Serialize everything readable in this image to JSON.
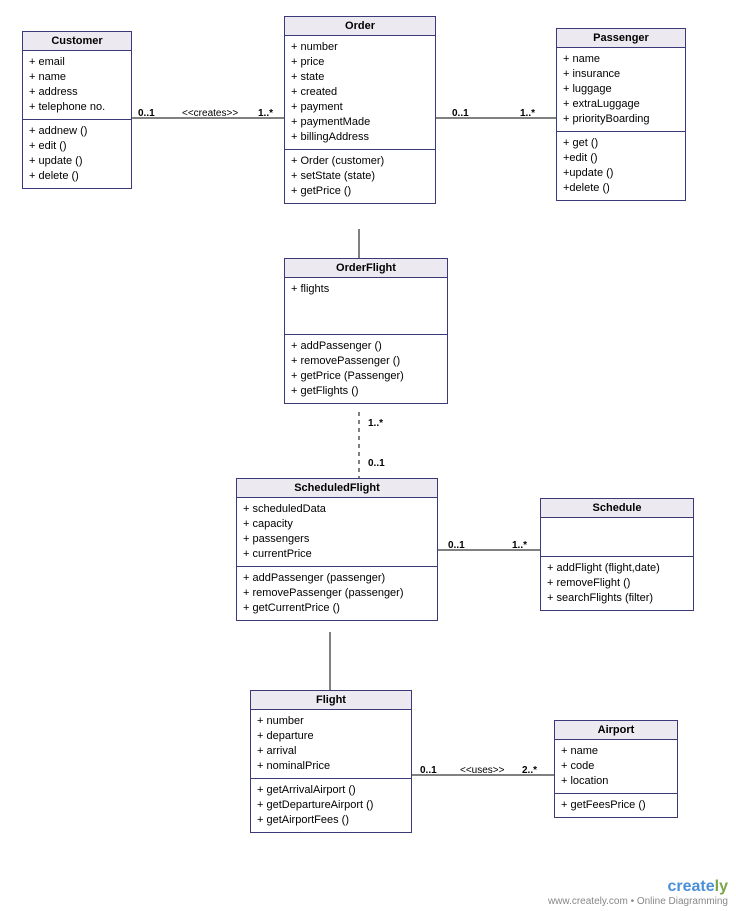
{
  "classes": {
    "customer": {
      "name": "Customer",
      "attrs": [
        "+ email",
        "+ name",
        "+ address",
        "+ telephone no."
      ],
      "ops": [
        "+ addnew ()",
        "+ edit ()",
        "+ update ()",
        "+ delete ()"
      ]
    },
    "order": {
      "name": "Order",
      "attrs": [
        "+ number",
        "+ price",
        "+ state",
        "+ created",
        "+ payment",
        "+ paymentMade",
        "+ billingAddress"
      ],
      "ops": [
        "+ Order (customer)",
        "+ setState (state)",
        "+ getPrice ()"
      ]
    },
    "passenger": {
      "name": "Passenger",
      "attrs": [
        "+ name",
        "+ insurance",
        "+ luggage",
        "+ extraLuggage",
        "+ priorityBoarding"
      ],
      "ops": [
        "+ get ()",
        "+edit ()",
        "+update ()",
        "+delete ()"
      ]
    },
    "orderFlight": {
      "name": "OrderFlight",
      "attrs": [
        "+ flights"
      ],
      "ops": [
        "+ addPassenger ()",
        "+ removePassenger ()",
        "+ getPrice (Passenger)",
        "+ getFlights ()"
      ]
    },
    "scheduledFlight": {
      "name": "ScheduledFlight",
      "attrs": [
        "+ scheduledData",
        "+ capacity",
        "+ passengers",
        "+ currentPrice"
      ],
      "ops": [
        "+ addPassenger (passenger)",
        "+ removePassenger (passenger)",
        "+ getCurrentPrice ()"
      ]
    },
    "schedule": {
      "name": "Schedule",
      "attrs": [],
      "ops": [
        "+ addFlight (flight,date)",
        "+ removeFlight ()",
        "+ searchFlights (filter)"
      ]
    },
    "flight": {
      "name": "Flight",
      "attrs": [
        "+ number",
        "+ departure",
        "+ arrival",
        "+ nominalPrice"
      ],
      "ops": [
        "+ getArrivalAirport ()",
        "+ getDepartureAirport ()",
        "+ getAirportFees ()"
      ]
    },
    "airport": {
      "name": "Airport",
      "attrs": [
        "+ name",
        "+ code",
        "+ location"
      ],
      "ops": [
        "+ getFeesPrice ()"
      ]
    }
  },
  "associations": {
    "customer_order": {
      "left": "0..1",
      "stereo": "<<creates>>",
      "right": "1..*"
    },
    "order_passenger": {
      "left": "0..1",
      "right": "1..*"
    },
    "orderFlight_scheduledFlight": {
      "top": "1..*",
      "bottom": "0..1"
    },
    "scheduledFlight_schedule": {
      "left": "0..1",
      "right": "1..*"
    },
    "flight_airport": {
      "left": "0..1",
      "stereo": "<<uses>>",
      "right": "2..*"
    }
  },
  "footer": {
    "brand1": "create",
    "brand2": "ly",
    "tagline": "www.creately.com • Online Diagramming"
  }
}
